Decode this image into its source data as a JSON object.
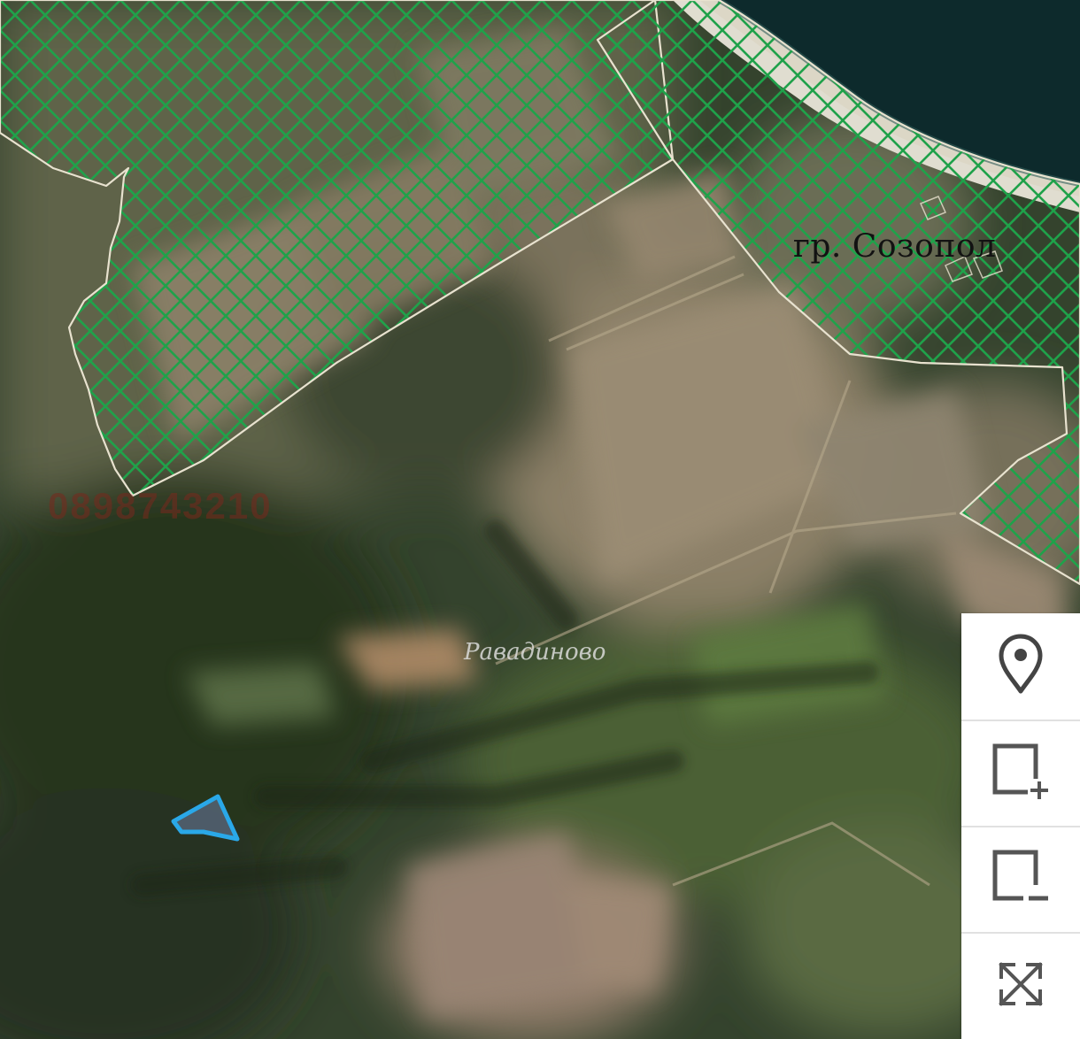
{
  "map": {
    "city_label": "гр. Созопол",
    "village_label": "Равадиново",
    "watermark": "0898743210"
  },
  "toolbar": {
    "buttons": [
      {
        "name": "add-marker",
        "icon": "map-pin-icon"
      },
      {
        "name": "zoom-in",
        "icon": "square-plus-icon"
      },
      {
        "name": "zoom-out",
        "icon": "square-minus-icon"
      },
      {
        "name": "fullscreen",
        "icon": "expand-arrows-icon"
      }
    ]
  },
  "colors": {
    "hatch": "#1fa24a",
    "parcel": "#2aa8e8",
    "boundary": "#e8e2cf",
    "sea": "#0d2a2c"
  }
}
